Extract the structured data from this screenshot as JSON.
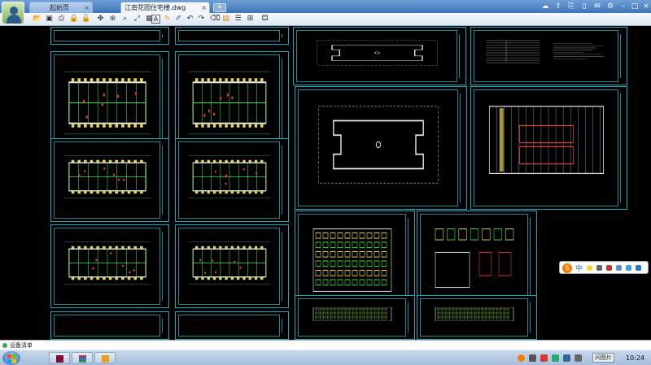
{
  "window": {
    "tabs": [
      {
        "label": "起始页",
        "active": false
      },
      {
        "label": "江南花园住宅楼.dwg",
        "active": true
      }
    ],
    "add_tab_label": "+",
    "title_icons": [
      "cloud-icon",
      "share-icon",
      "export-icon",
      "mobile-icon",
      "mail-icon",
      "settings-icon",
      "minimize-icon",
      "maximize-icon",
      "close-icon"
    ]
  },
  "toolbar": {
    "tools": [
      "open-icon",
      "save-icon",
      "print-icon",
      "lock-icon",
      "lock-alt-icon",
      "pan-icon",
      "zoom-window-icon",
      "zoom-icon",
      "zoom-fit-icon",
      "layout-icon",
      "text-icon",
      "pen-icon",
      "markup-icon",
      "undo-icon",
      "redo-icon",
      "erase-icon",
      "layers-icon",
      "properties-icon",
      "measure-icon",
      "table-icon"
    ],
    "text_tool_label": "A"
  },
  "ime": {
    "logo": "S",
    "mode_label": "中"
  },
  "status": {
    "text": "设备清单"
  },
  "taskbar": {
    "tasks": [
      "video-app",
      "archive-app",
      "cad-viewer-app"
    ],
    "tray_label": "问图片",
    "clock": "10:24"
  },
  "colors": {
    "sheet_border": "#1aa9b8",
    "wall_green": "#38e048",
    "wall_white": "#e8e8e8",
    "accent_yellow": "#e8d84a",
    "accent_red": "#e23a3a",
    "titlebar": "#3f74b8"
  }
}
